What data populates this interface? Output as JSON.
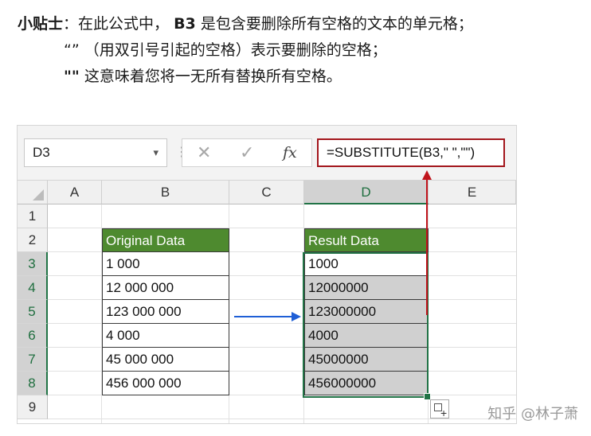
{
  "tip": {
    "title": "小贴士",
    "line1_text": "：在此公式中，",
    "line1_ref": "B3",
    "line1_rest": " 是包含要删除所有空格的文本的单元格；",
    "line2": "“” （用双引号引起的空格）表示要删除的空格；",
    "line3_code": "\"\"",
    "line3_rest": " 这意味着您将一无所有替换所有空格。"
  },
  "formula_bar": {
    "name_box": "D3",
    "dropdown_glyph": "▾",
    "dots_glyph": "⋮",
    "cancel_glyph": "✕",
    "enter_glyph": "✓",
    "fx_label": "fx",
    "formula": "=SUBSTITUTE(B3,\" \",\"\")"
  },
  "columns": [
    "A",
    "B",
    "C",
    "D",
    "E"
  ],
  "rows": [
    "1",
    "2",
    "3",
    "4",
    "5",
    "6",
    "7",
    "8",
    "9"
  ],
  "original": {
    "header": "Original Data",
    "values": [
      "1 000",
      "12 000 000",
      "123 000 000",
      "4 000",
      "45 000 000",
      "456 000 000"
    ]
  },
  "result": {
    "header": "Result Data",
    "values": [
      "1000",
      "12000000",
      "123000000",
      "4000",
      "45000000",
      "456000000"
    ]
  },
  "colors": {
    "header_green": "#4e8a2f",
    "selection_green": "#217346",
    "formula_border": "#a3161c",
    "arrow_blue": "#1f5fd6",
    "arrow_red": "#c0141c"
  },
  "watermark": "知乎 @林子萧"
}
